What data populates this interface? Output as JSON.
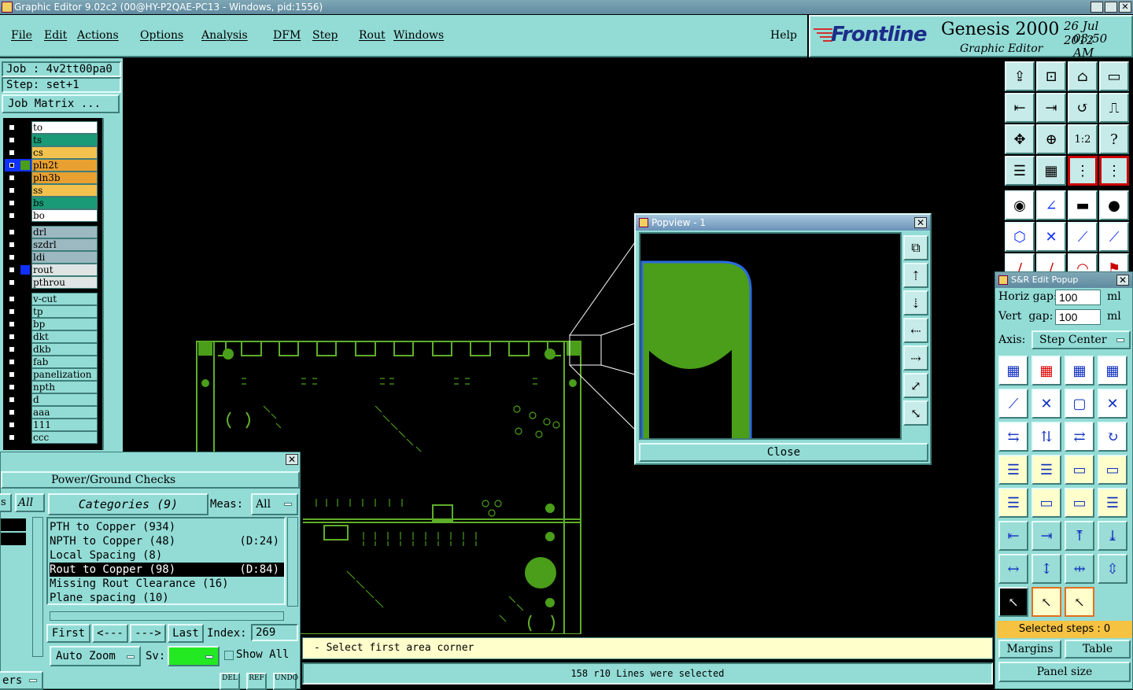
{
  "window": {
    "title": "Graphic Editor 9.02c2 (00@HY-P2QAE-PC13 - Windows, pid:1556)"
  },
  "menu": {
    "items": [
      "File",
      "Edit",
      "Actions",
      "Options",
      "Analysis",
      "DFM",
      "Step",
      "Rout",
      "Windows"
    ],
    "help": "Help"
  },
  "brand": {
    "logo": "Frontline",
    "product": "Genesis 2000",
    "subtitle": "Graphic Editor",
    "date": "26 Jul 2012",
    "time": "03:50 AM"
  },
  "job": {
    "job_label": "Job : 4v2tt00pa0",
    "step_label": "Step: set+1",
    "matrix_button": "Job Matrix ..."
  },
  "layers": [
    {
      "name": "to",
      "color": "#ffffff",
      "checked": false
    },
    {
      "name": "ts",
      "color": "#1a9a76",
      "checked": false
    },
    {
      "name": "cs",
      "color": "#f2c14e",
      "checked": false
    },
    {
      "name": "pln2t",
      "color": "#e8a030",
      "checked": true,
      "swatch": "#4a9e1a"
    },
    {
      "name": "pln3b",
      "color": "#e8a030",
      "checked": false
    },
    {
      "name": "ss",
      "color": "#f2c14e",
      "checked": false
    },
    {
      "name": "bs",
      "color": "#1a9a76",
      "checked": false
    },
    {
      "name": "bo",
      "color": "#ffffff",
      "checked": false
    },
    {
      "name": "drl",
      "color": "#9cb8c0",
      "checked": false
    },
    {
      "name": "szdrl",
      "color": "#9cb8c0",
      "checked": false
    },
    {
      "name": "ldi",
      "color": "#9cb8c0",
      "checked": false
    },
    {
      "name": "rout",
      "color": "#dfe5e5",
      "checked": false,
      "swatch": "#1030ff"
    },
    {
      "name": "pthrou",
      "color": "#dfe5e5",
      "checked": false
    },
    {
      "name": "v-cut",
      "color": "#93dcd6",
      "checked": false
    },
    {
      "name": "tp",
      "color": "#93dcd6",
      "checked": false
    },
    {
      "name": "bp",
      "color": "#93dcd6",
      "checked": false
    },
    {
      "name": "dkt",
      "color": "#93dcd6",
      "checked": false
    },
    {
      "name": "dkb",
      "color": "#93dcd6",
      "checked": false
    },
    {
      "name": "fab",
      "color": "#93dcd6",
      "checked": false
    },
    {
      "name": "panelization",
      "color": "#93dcd6",
      "checked": false
    },
    {
      "name": "npth",
      "color": "#93dcd6",
      "checked": false
    },
    {
      "name": "d",
      "color": "#93dcd6",
      "checked": false
    },
    {
      "name": "aaa",
      "color": "#93dcd6",
      "checked": false
    },
    {
      "name": "111",
      "color": "#93dcd6",
      "checked": false
    },
    {
      "name": "ccc",
      "color": "#93dcd6",
      "checked": false
    }
  ],
  "popview": {
    "title": "Popview - 1",
    "close_button": "Close"
  },
  "sr": {
    "title": "S&R Edit Popup",
    "hgap_label": "Horiz gap:",
    "hgap_value": "100",
    "hgap_unit": "ml",
    "vgap_label": "Vert  gap:",
    "vgap_value": "100",
    "vgap_unit": "ml",
    "axis_label": "Axis:",
    "axis_value": "Step Center",
    "selected_steps": "Selected steps : 0",
    "margins": "Margins",
    "table": "Table",
    "panel_size": "Panel size"
  },
  "pg": {
    "title": "Power/Ground Checks",
    "all_tab": "All",
    "categories_title": "Categories (9)",
    "meas_label": "Meas:",
    "meas_value": "All",
    "categories": [
      {
        "name": "PTH to Copper (934)",
        "d": ""
      },
      {
        "name": "NPTH to Copper (48)",
        "d": "(D:24)"
      },
      {
        "name": "Local Spacing (8)",
        "d": ""
      },
      {
        "name": "Rout to Copper (98)",
        "d": "(D:84)",
        "selected": true
      },
      {
        "name": "Missing Rout Clearance (16)",
        "d": ""
      },
      {
        "name": "Plane spacing (10)",
        "d": ""
      }
    ],
    "first": "First",
    "prev": "<---",
    "next": "--->",
    "last": "Last",
    "index_label": "Index:",
    "index_value": "269",
    "auto_zoom": "Auto Zoom",
    "sv_label": "Sv:",
    "show_all": "Show All",
    "bottom_left": "ers",
    "del": "DEL",
    "ref": "REF",
    "undo": "UNDO"
  },
  "prompt": "- Select first area corner",
  "status": "158 r10 Lines were selected",
  "colors": {
    "panel": "#93dcd6",
    "copper": "#4a9e1a",
    "outline": "#5fae2a",
    "highlight": "#2a6ae0"
  }
}
